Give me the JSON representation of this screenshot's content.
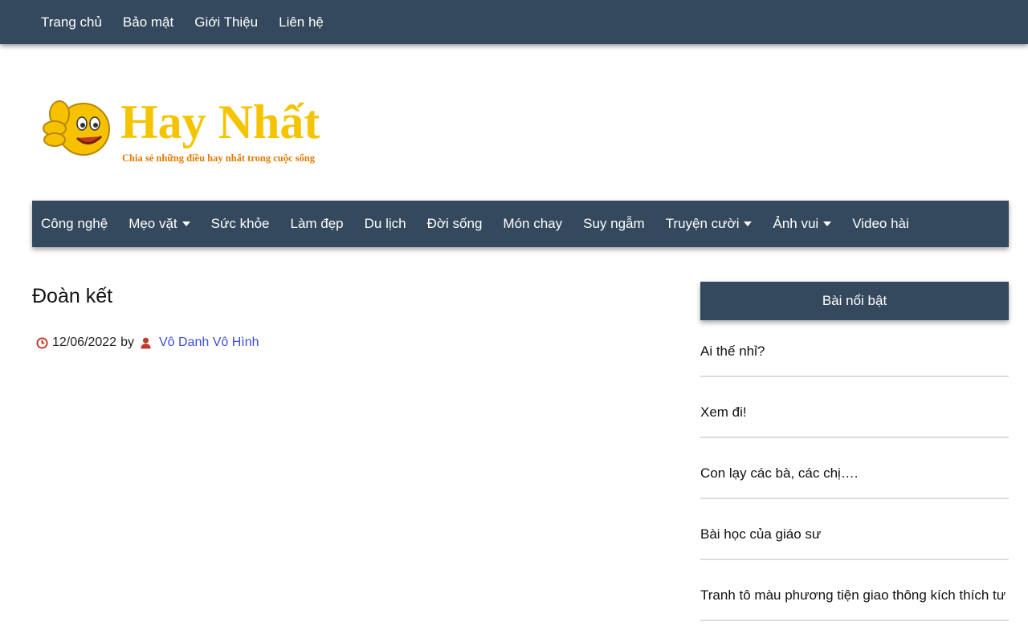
{
  "topbar": {
    "items": [
      {
        "label": "Trang chủ"
      },
      {
        "label": "Bảo mật"
      },
      {
        "label": "Giới Thiệu"
      },
      {
        "label": "Liên hệ"
      }
    ]
  },
  "logo": {
    "title": "Hay Nhất",
    "tagline": "Chia sẻ những điều hay nhất trong cuộc sống",
    "title_color": "#f5c400",
    "tagline_color": "#e07b00"
  },
  "mainnav": {
    "items": [
      {
        "label": "Công nghệ",
        "dropdown": false
      },
      {
        "label": "Mẹo vặt",
        "dropdown": true
      },
      {
        "label": "Sức khỏe",
        "dropdown": false
      },
      {
        "label": "Làm đẹp",
        "dropdown": false
      },
      {
        "label": "Du lịch",
        "dropdown": false
      },
      {
        "label": "Đời sống",
        "dropdown": false
      },
      {
        "label": "Món chay",
        "dropdown": false
      },
      {
        "label": "Suy ngẫm",
        "dropdown": false
      },
      {
        "label": "Truyện cười",
        "dropdown": true
      },
      {
        "label": "Ảnh vui",
        "dropdown": true
      },
      {
        "label": "Video hài",
        "dropdown": false
      }
    ]
  },
  "post": {
    "title": "Đoàn kết",
    "date": "12/06/2022",
    "by": "by",
    "author": "Vô Danh Vô Hình"
  },
  "sidebar": {
    "widget_title": "Bài nổi bật",
    "items": [
      {
        "label": "Ai thế nhỉ?"
      },
      {
        "label": "Xem đi!"
      },
      {
        "label": "Con lạy các bà, các chị…."
      },
      {
        "label": "Bài học của giáo sư"
      },
      {
        "label": "Tranh tô màu phương tiện giao thông kích thích tư"
      }
    ]
  },
  "colors": {
    "nav_bg": "#34495e",
    "meta_icon": "#c0392b",
    "link": "#3b4ed6"
  }
}
